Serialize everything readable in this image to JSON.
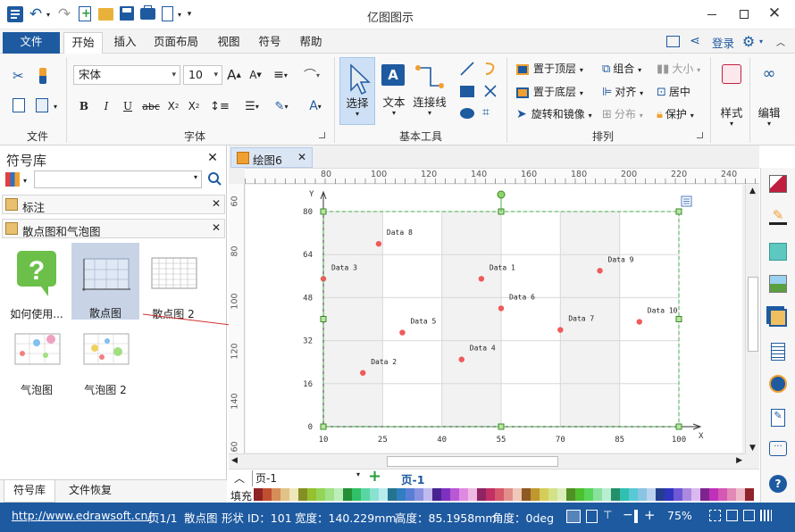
{
  "app": {
    "title": "亿图图示",
    "window_controls": [
      "minimize",
      "maximize",
      "close"
    ]
  },
  "ribbon_tabs": {
    "file": "文件",
    "start": "开始",
    "insert": "插入",
    "page_layout": "页面布局",
    "view": "视图",
    "symbol": "符号",
    "help": "帮助",
    "login": "登录"
  },
  "ribbon": {
    "font_name": "宋体",
    "font_size": "10",
    "groups": {
      "file": "文件",
      "font": "字体",
      "basic_tools": "基本工具",
      "arrange": "排列"
    },
    "tools": {
      "select": "选择",
      "text": "文本",
      "connector": "连接线"
    },
    "arrange": {
      "bring_front": "置于顶层",
      "send_back": "置于底层",
      "rotate_mirror": "旋转和镜像",
      "group": "组合",
      "align": "对齐",
      "distribute": "分布",
      "size": "大小",
      "center": "居中",
      "protect": "保护"
    },
    "style": "样式",
    "edit": "编辑"
  },
  "left_panel": {
    "title": "符号库",
    "search_placeholder": "",
    "libraries": [
      "标注",
      "散点图和气泡图"
    ],
    "shapes": [
      "如何使用...",
      "散点图",
      "散点图 2",
      "气泡图",
      "气泡图 2"
    ],
    "bottom_tabs": [
      "符号库",
      "文件恢复"
    ]
  },
  "document": {
    "tab_title": "绘图6",
    "ruler_top": [
      "80",
      "100",
      "120",
      "140",
      "160",
      "180",
      "200",
      "220",
      "240"
    ],
    "ruler_left": [
      "60",
      "80",
      "100",
      "120",
      "140",
      "160"
    ],
    "page_selector": "页-1",
    "page_tab": "页-1",
    "fill_label": "填充"
  },
  "chart_data": {
    "type": "scatter",
    "xlabel": "X",
    "ylabel": "Y",
    "xlim": [
      10,
      100
    ],
    "ylim": [
      0,
      80
    ],
    "xticks": [
      10,
      25,
      40,
      55,
      70,
      85,
      100
    ],
    "yticks": [
      0,
      16,
      32,
      48,
      64,
      80
    ],
    "grid": true,
    "points": [
      {
        "label": "Data 1",
        "x": 50,
        "y": 55
      },
      {
        "label": "Data 2",
        "x": 20,
        "y": 20
      },
      {
        "label": "Data 3",
        "x": 10,
        "y": 55
      },
      {
        "label": "Data 4",
        "x": 45,
        "y": 25
      },
      {
        "label": "Data 5",
        "x": 30,
        "y": 35
      },
      {
        "label": "Data 6",
        "x": 55,
        "y": 44
      },
      {
        "label": "Data 7",
        "x": 70,
        "y": 36
      },
      {
        "label": "Data 8",
        "x": 24,
        "y": 68
      },
      {
        "label": "Data 9",
        "x": 80,
        "y": 58
      },
      {
        "label": "Data 10",
        "x": 90,
        "y": 39
      }
    ],
    "point_color": "#f05a5a"
  },
  "status": {
    "url": "http://www.edrawsoft.cn/",
    "page": "页1/1",
    "shape": "散点图",
    "shape_id": "形状 ID：101",
    "width": "宽度：140.229mm",
    "height": "高度：85.1958mm",
    "angle": "角度：0deg",
    "zoom": "75%"
  },
  "colors": {
    "accent": "#1e5aa0",
    "file_tab": "#1e5aa0"
  }
}
